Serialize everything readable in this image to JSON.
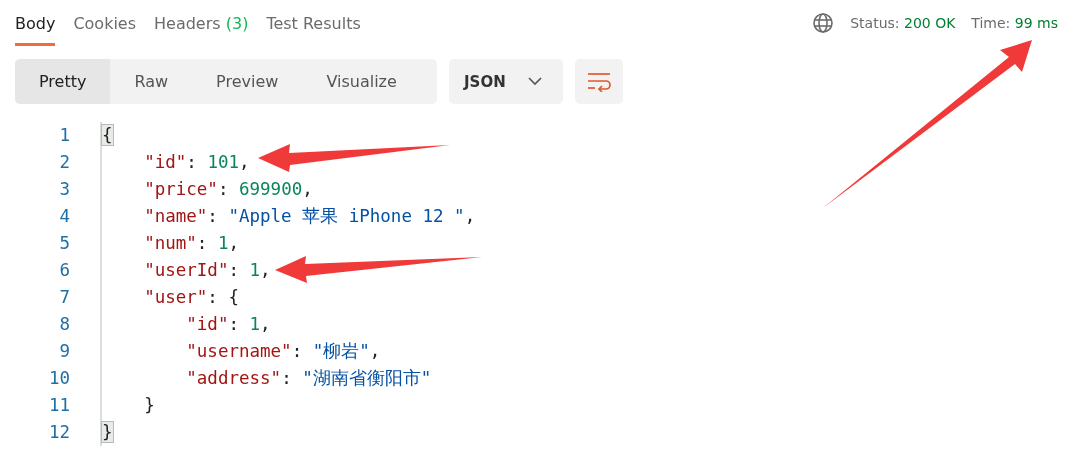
{
  "tabs": [
    {
      "label": "Body",
      "selected": true
    },
    {
      "label": "Cookies",
      "selected": false
    },
    {
      "label": "Headers",
      "count": "(3)",
      "selected": false
    },
    {
      "label": "Test Results",
      "selected": false
    }
  ],
  "status": {
    "label": "Status:",
    "value": "200 OK"
  },
  "time": {
    "label": "Time:",
    "value": "99 ms"
  },
  "view_modes": [
    {
      "label": "Pretty",
      "selected": true
    },
    {
      "label": "Raw",
      "selected": false
    },
    {
      "label": "Preview",
      "selected": false
    },
    {
      "label": "Visualize",
      "selected": false
    }
  ],
  "format_dropdown": {
    "value": "JSON"
  },
  "code_lines": [
    {
      "number": "1",
      "tokens": [
        {
          "kind": "brace-match",
          "text": "{"
        }
      ]
    },
    {
      "number": "2",
      "tokens": [
        {
          "kind": "key",
          "text": "    \"id\""
        },
        {
          "kind": "punct",
          "text": ": "
        },
        {
          "kind": "number",
          "text": "101"
        },
        {
          "kind": "punct",
          "text": ","
        }
      ]
    },
    {
      "number": "3",
      "tokens": [
        {
          "kind": "key",
          "text": "    \"price\""
        },
        {
          "kind": "punct",
          "text": ": "
        },
        {
          "kind": "number",
          "text": "699900"
        },
        {
          "kind": "punct",
          "text": ","
        }
      ]
    },
    {
      "number": "4",
      "tokens": [
        {
          "kind": "key",
          "text": "    \"name\""
        },
        {
          "kind": "punct",
          "text": ": "
        },
        {
          "kind": "string",
          "text": "\"Apple 苹果 iPhone 12 \""
        },
        {
          "kind": "punct",
          "text": ","
        }
      ]
    },
    {
      "number": "5",
      "tokens": [
        {
          "kind": "key",
          "text": "    \"num\""
        },
        {
          "kind": "punct",
          "text": ": "
        },
        {
          "kind": "number",
          "text": "1"
        },
        {
          "kind": "punct",
          "text": ","
        }
      ]
    },
    {
      "number": "6",
      "tokens": [
        {
          "kind": "key",
          "text": "    \"userId\""
        },
        {
          "kind": "punct",
          "text": ": "
        },
        {
          "kind": "number",
          "text": "1"
        },
        {
          "kind": "punct",
          "text": ","
        }
      ]
    },
    {
      "number": "7",
      "tokens": [
        {
          "kind": "key",
          "text": "    \"user\""
        },
        {
          "kind": "punct",
          "text": ": {"
        }
      ]
    },
    {
      "number": "8",
      "tokens": [
        {
          "kind": "key",
          "text": "        \"id\""
        },
        {
          "kind": "punct",
          "text": ": "
        },
        {
          "kind": "number",
          "text": "1"
        },
        {
          "kind": "punct",
          "text": ","
        }
      ]
    },
    {
      "number": "9",
      "tokens": [
        {
          "kind": "key",
          "text": "        \"username\""
        },
        {
          "kind": "punct",
          "text": ": "
        },
        {
          "kind": "string",
          "text": "\"柳岩\""
        },
        {
          "kind": "punct",
          "text": ","
        }
      ]
    },
    {
      "number": "10",
      "tokens": [
        {
          "kind": "key",
          "text": "        \"address\""
        },
        {
          "kind": "punct",
          "text": ": "
        },
        {
          "kind": "string",
          "text": "\"湖南省衡阳市\""
        }
      ]
    },
    {
      "number": "11",
      "tokens": [
        {
          "kind": "punct",
          "text": "    }"
        }
      ]
    },
    {
      "number": "12",
      "tokens": [
        {
          "kind": "brace-match",
          "text": "}"
        }
      ]
    }
  ]
}
